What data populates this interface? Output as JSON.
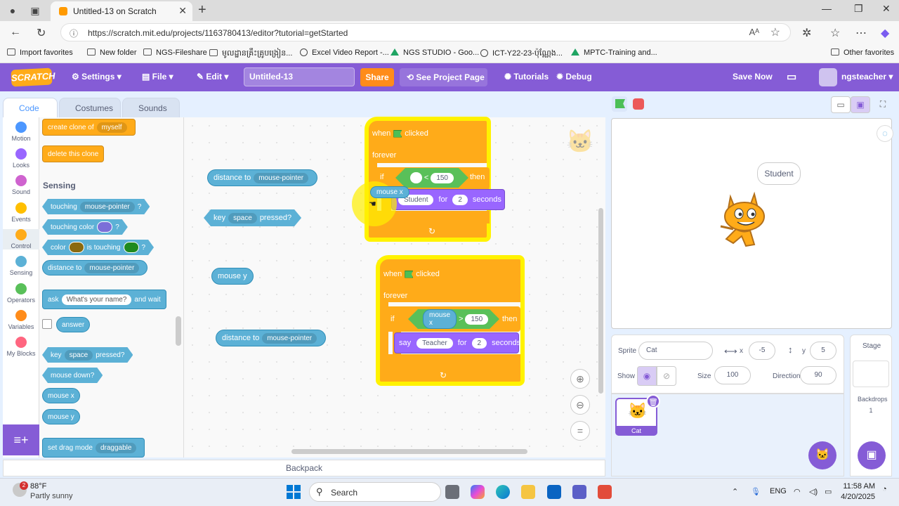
{
  "browser": {
    "tab_title": "Untitled-13 on Scratch",
    "url": "https://scratch.mit.edu/projects/1163780413/editor?tutorial=getStarted",
    "bookmarks": [
      "Import favorites",
      "New folder",
      "NGS-Fileshare",
      "មូលដ្ឋានគ្រឹះគ្រូបង្រៀន...",
      "Excel Video Report -...",
      "NGS STUDIO - Goo...",
      "ICT-Y22-23-ប៉ុណ្ណែង...",
      "MPTC-Training and..."
    ],
    "other_favorites": "Other favorites"
  },
  "menu": {
    "logo": "SCRATCH",
    "settings": "Settings",
    "file": "File",
    "edit": "Edit",
    "project_title": "Untitled-13",
    "share": "Share",
    "see_project_page": "See Project Page",
    "tutorials": "Tutorials",
    "debug": "Debug",
    "save_now": "Save Now",
    "username": "ngsteacher"
  },
  "tabs": {
    "code": "Code",
    "costumes": "Costumes",
    "sounds": "Sounds"
  },
  "categories": [
    {
      "label": "Motion",
      "color": "#4c97ff"
    },
    {
      "label": "Looks",
      "color": "#9966ff"
    },
    {
      "label": "Sound",
      "color": "#cf63cf"
    },
    {
      "label": "Events",
      "color": "#ffbf00"
    },
    {
      "label": "Control",
      "color": "#ffab19"
    },
    {
      "label": "Sensing",
      "color": "#5cb1d6"
    },
    {
      "label": "Operators",
      "color": "#59c059"
    },
    {
      "label": "Variables",
      "color": "#ff8c1a"
    },
    {
      "label": "My Blocks",
      "color": "#ff6680"
    }
  ],
  "palette": {
    "create_clone": "create clone of",
    "myself": "myself",
    "delete_clone": "delete this clone",
    "sensing_heading": "Sensing",
    "touching": "touching",
    "mouse_pointer": "mouse-pointer",
    "q": "?",
    "touching_color": "touching color",
    "color": "color",
    "is_touching": "is touching",
    "distance_to": "distance to",
    "ask": "ask",
    "ask_default": "What's your name?",
    "and_wait": "and wait",
    "answer": "answer",
    "key": "key",
    "space": "space",
    "pressed": "pressed?",
    "mouse_down": "mouse down?",
    "mouse_x": "mouse x",
    "mouse_y": "mouse y",
    "set_drag_mode": "set drag mode",
    "draggable": "draggable"
  },
  "workspace": {
    "loose_distance1": "distance to",
    "loose_distance1_menu": "mouse-pointer",
    "loose_key": "key",
    "loose_key_menu": "space",
    "loose_key_pressed": "pressed?",
    "loose_mouse_y": "mouse y",
    "loose_distance2": "distance to",
    "loose_distance2_menu": "mouse-pointer",
    "script1": {
      "when": "when",
      "clicked": "clicked",
      "forever": "forever",
      "if": "if",
      "op": "<",
      "value": "150",
      "then": "then",
      "dragged": "mouse x",
      "say_text": "Student",
      "for": "for",
      "secs": "2",
      "seconds": "seconds"
    },
    "script2": {
      "when": "when",
      "clicked": "clicked",
      "forever": "forever",
      "if": "if",
      "reporter": "mouse x",
      "op": ">",
      "value": "150",
      "then": "then",
      "say": "say",
      "say_text": "Teacher",
      "for": "for",
      "secs": "2",
      "seconds": "seconds"
    },
    "backpack": "Backpack"
  },
  "stage": {
    "bubble": "Student"
  },
  "sprite_info": {
    "sprite_label": "Sprite",
    "sprite_name": "Cat",
    "x_label": "x",
    "x_value": "-5",
    "y_label": "y",
    "y_value": "5",
    "show_label": "Show",
    "size_label": "Size",
    "size_value": "100",
    "direction_label": "Direction",
    "direction_value": "90",
    "thumb_label": "Cat"
  },
  "stage_panel": {
    "label": "Stage",
    "backdrops_label": "Backdrops",
    "backdrops_count": "1"
  },
  "taskbar": {
    "weather_badge": "2",
    "temp": "88°F",
    "condition": "Partly sunny",
    "search": "Search",
    "lang": "ENG",
    "time": "11:58 AM",
    "date": "4/20/2025"
  }
}
